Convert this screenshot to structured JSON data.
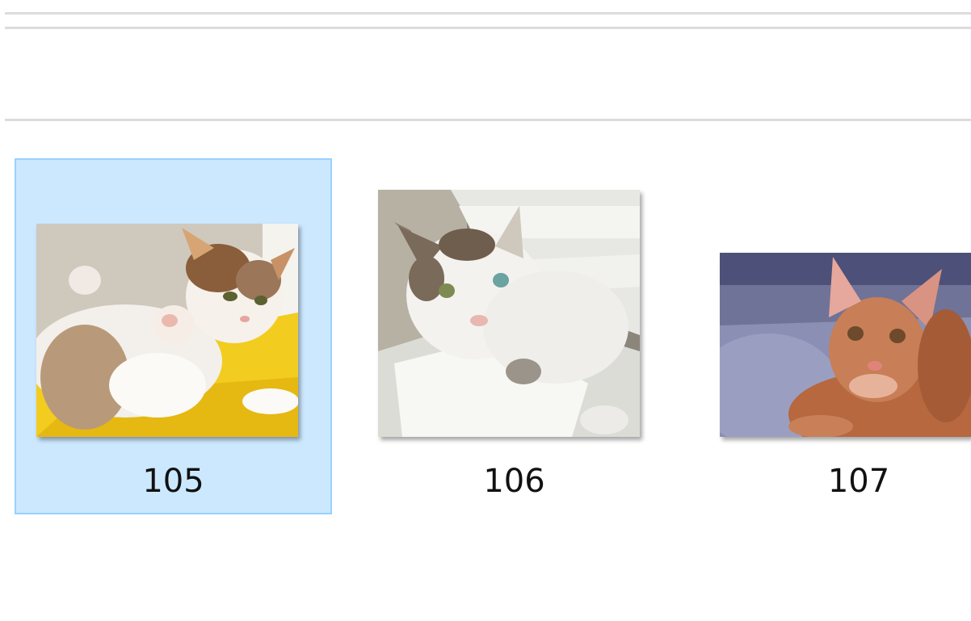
{
  "files": [
    {
      "name": "105",
      "selected": true,
      "thumbnail_icon": "cat-photo-icon"
    },
    {
      "name": "106",
      "selected": false,
      "thumbnail_icon": "cat-photo-icon"
    },
    {
      "name": "107",
      "selected": false,
      "thumbnail_icon": "cat-photo-icon"
    }
  ],
  "colors": {
    "selection_background": "#cce8ff",
    "selection_border": "#99d1ff",
    "divider": "#dcdcdc",
    "label_text": "#111111"
  }
}
